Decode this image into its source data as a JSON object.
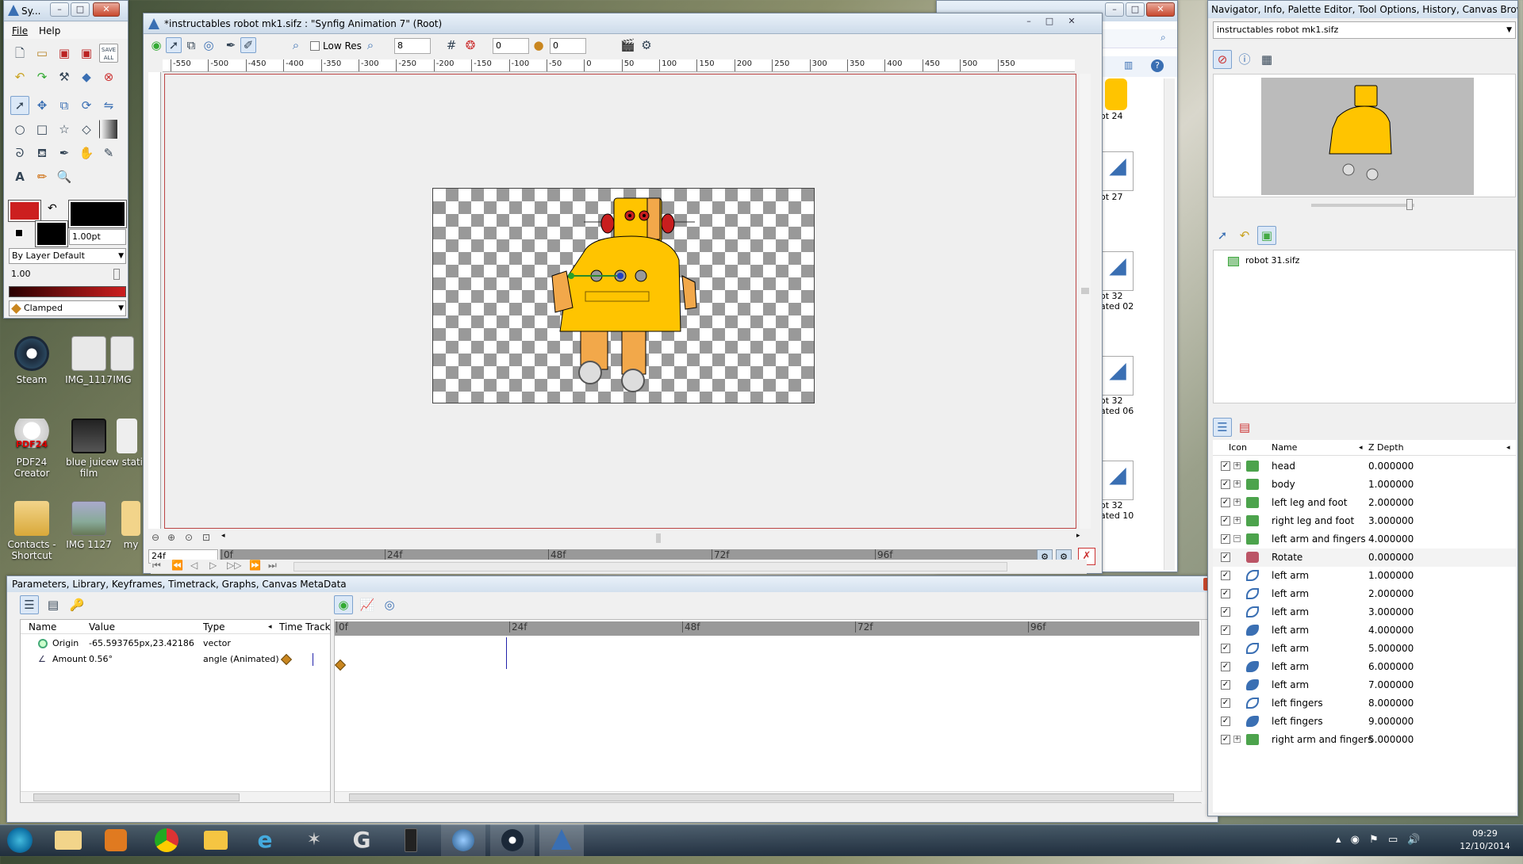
{
  "colors": {
    "fill": "#cc1f1f",
    "outline": "#000000",
    "robot": "#ffc400",
    "accent": "#3a6fb3"
  },
  "toolbox": {
    "title": "Sy...",
    "menu": {
      "file": "File",
      "help": "Help"
    },
    "save_all": "SAVE ALL",
    "width_value": "1.00pt",
    "blend_method": "By Layer Default",
    "opacity": "1.00",
    "interpolation": "Clamped"
  },
  "desktop_icons": [
    {
      "label": "Steam"
    },
    {
      "label": "IMG_1117"
    },
    {
      "label": "IMG"
    },
    {
      "label": "PDF24 Creator"
    },
    {
      "label": "blue juice film"
    },
    {
      "label": "w stati"
    },
    {
      "label": "Contacts - Shortcut"
    },
    {
      "label": "IMG 1127"
    },
    {
      "label": "my"
    }
  ],
  "canvas_window": {
    "title": "*instructables robot mk1.sifz : \"Synfig Animation 7\" (Root)",
    "low_res": "Low Res",
    "quality": "8",
    "onion_past": "0",
    "onion_future": "0",
    "ruler_labels": [
      "-550",
      "-500",
      "-450",
      "-400",
      "-350",
      "-300",
      "-250",
      "-200",
      "-150",
      "-100",
      "-50",
      "0",
      "50",
      "100",
      "150",
      "200",
      "250",
      "300",
      "350",
      "400",
      "450",
      "500",
      "550"
    ],
    "current_time": "24f",
    "timebar_labels": [
      "0f",
      "24f",
      "48f",
      "72f",
      "96f"
    ]
  },
  "file_browser": {
    "items": [
      {
        "label": "ot 24"
      },
      {
        "label": "ot 27"
      },
      {
        "label": "ot 32 ated 02"
      },
      {
        "label": "ot 32 ated 06"
      },
      {
        "label": "ot 32 ated 10"
      }
    ]
  },
  "right_panel": {
    "title": "Navigator, Info, Palette Editor, Tool Options, History, Canvas Brows...",
    "file_select": "instructables robot mk1.sifz",
    "canvas_tree_item": "robot 31.sifz",
    "layers_header": {
      "icon": "Icon",
      "name": "Name",
      "zdepth": "Z Depth"
    },
    "layers": [
      {
        "name": "head",
        "z": "0.000000",
        "kind": "folder",
        "expand": "+",
        "checked": "✓"
      },
      {
        "name": "body",
        "z": "1.000000",
        "kind": "folder",
        "expand": "+",
        "checked": "✓"
      },
      {
        "name": "left leg and foot",
        "z": "2.000000",
        "kind": "folder",
        "expand": "+",
        "checked": "✓"
      },
      {
        "name": "right leg and foot",
        "z": "3.000000",
        "kind": "folder",
        "expand": "+",
        "checked": "✓"
      },
      {
        "name": "left arm and fingers",
        "z": "4.000000",
        "kind": "folder",
        "expand": "−",
        "checked": "✓"
      },
      {
        "name": "Rotate",
        "z": "0.000000",
        "kind": "rotate",
        "expand": "",
        "checked": "✓"
      },
      {
        "name": "left arm",
        "z": "1.000000",
        "kind": "outline",
        "expand": "",
        "checked": "✓"
      },
      {
        "name": "left arm",
        "z": "2.000000",
        "kind": "outline",
        "expand": "",
        "checked": "✓"
      },
      {
        "name": "left arm",
        "z": "3.000000",
        "kind": "outline",
        "expand": "",
        "checked": "✓"
      },
      {
        "name": "left arm",
        "z": "4.000000",
        "kind": "region",
        "expand": "",
        "checked": "✓"
      },
      {
        "name": "left arm",
        "z": "5.000000",
        "kind": "outline",
        "expand": "",
        "checked": "✓"
      },
      {
        "name": "left arm",
        "z": "6.000000",
        "kind": "region",
        "expand": "",
        "checked": "✓"
      },
      {
        "name": "left arm",
        "z": "7.000000",
        "kind": "region",
        "expand": "",
        "checked": "✓"
      },
      {
        "name": "left fingers",
        "z": "8.000000",
        "kind": "outline",
        "expand": "",
        "checked": "✓"
      },
      {
        "name": "left fingers",
        "z": "9.000000",
        "kind": "region",
        "expand": "",
        "checked": "✓"
      },
      {
        "name": "right arm and fingers",
        "z": "5.000000",
        "kind": "folder",
        "expand": "+",
        "checked": "✓"
      }
    ]
  },
  "params_panel": {
    "title": "Parameters, Library, Keyframes, Timetrack, Graphs, Canvas MetaData",
    "columns": {
      "name": "Name",
      "value": "Value",
      "type": "Type",
      "timetrack": "Time Track"
    },
    "rows": [
      {
        "name": "Origin",
        "value": "-65.593765px,23.42186",
        "type": "vector"
      },
      {
        "name": "Amount",
        "value": "0.56°",
        "type": "angle (Animated)"
      }
    ],
    "timetrack_labels": [
      "0f",
      "24f",
      "48f",
      "72f",
      "96f"
    ]
  },
  "taskbar": {
    "time": "09:29",
    "date": "12/10/2014"
  }
}
